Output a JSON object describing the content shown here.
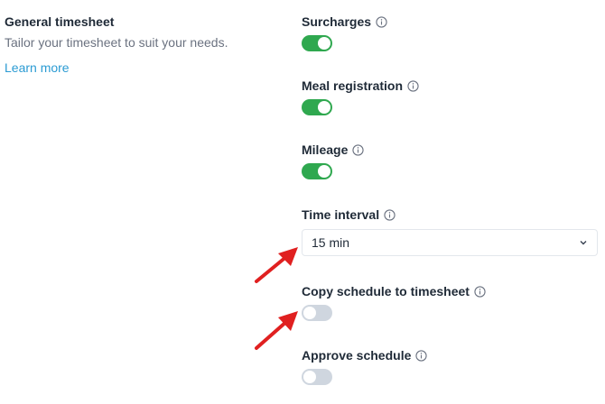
{
  "section": {
    "title": "General timesheet",
    "description": "Tailor your timesheet to suit your needs.",
    "learn_more": "Learn more"
  },
  "settings": {
    "surcharges": {
      "label": "Surcharges",
      "enabled": true
    },
    "meal_registration": {
      "label": "Meal registration",
      "enabled": true
    },
    "mileage": {
      "label": "Mileage",
      "enabled": true
    },
    "time_interval": {
      "label": "Time interval",
      "value": "15 min"
    },
    "copy_schedule": {
      "label": "Copy schedule to timesheet",
      "enabled": false
    },
    "approve_schedule": {
      "label": "Approve schedule",
      "enabled": false
    }
  },
  "colors": {
    "toggle_on": "#2fa84f",
    "toggle_off": "#cfd6df",
    "link": "#2b9bd3",
    "annotation_arrow": "#e02020"
  },
  "icons": {
    "info": "info-circle-icon",
    "dropdown": "chevron-down-icon"
  }
}
